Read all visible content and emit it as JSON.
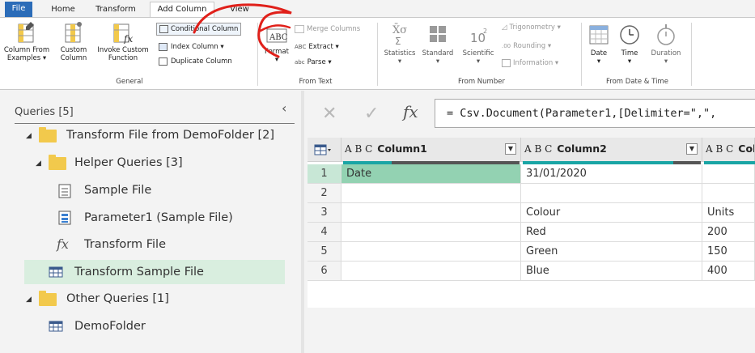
{
  "tabs": [
    "File",
    "Home",
    "Transform",
    "Add Column",
    "View"
  ],
  "ribbon": {
    "general": {
      "column_from_examples": [
        "Column From",
        "Examples"
      ],
      "custom_column": [
        "Custom",
        "Column"
      ],
      "invoke_custom_function": [
        "Invoke Custom",
        "Function"
      ],
      "conditional_column": "Conditional Column",
      "index_column": "Index Column",
      "duplicate_column": "Duplicate Column",
      "group_label": "General"
    },
    "from_text": {
      "format": "Format",
      "merge_columns": "Merge Columns",
      "extract": "Extract",
      "parse": "Parse",
      "group_label": "From Text"
    },
    "from_number": {
      "statistics": "Statistics",
      "standard": "Standard",
      "scientific": "Scientific",
      "trigonometry": "Trigonometry",
      "rounding": "Rounding",
      "information": "Information",
      "group_label": "From Number"
    },
    "from_date_time": {
      "date": "Date",
      "time": "Time",
      "duration": "Duration",
      "group_label": "From Date & Time"
    }
  },
  "queries": {
    "header": "Queries [5]",
    "items": [
      {
        "label": "Transform File from DemoFolder [2]",
        "type": "folder"
      },
      {
        "label": "Helper Queries [3]",
        "type": "folder"
      },
      {
        "label": "Sample File",
        "type": "file"
      },
      {
        "label": "Parameter1 (Sample File)",
        "type": "parameter"
      },
      {
        "label": "Transform File",
        "type": "function"
      },
      {
        "label": "Transform Sample File",
        "type": "table"
      },
      {
        "label": "Other Queries [1]",
        "type": "folder"
      },
      {
        "label": "DemoFolder",
        "type": "table"
      }
    ]
  },
  "formula_bar": {
    "fx": "fx",
    "formula": "= Csv.Document(Parameter1,[Delimiter=\",\","
  },
  "grid": {
    "columns": [
      {
        "type": "A B C",
        "name": "Column1"
      },
      {
        "type": "A B C",
        "name": "Column2"
      },
      {
        "type": "A B C",
        "name": "Colu"
      }
    ],
    "rows": [
      {
        "n": "1",
        "c1": "Date",
        "c2": "31/01/2020",
        "c3": ""
      },
      {
        "n": "2",
        "c1": "",
        "c2": "",
        "c3": ""
      },
      {
        "n": "3",
        "c1": "",
        "c2": "Colour",
        "c3": "Units"
      },
      {
        "n": "4",
        "c1": "",
        "c2": "Red",
        "c3": "200"
      },
      {
        "n": "5",
        "c1": "",
        "c2": "Green",
        "c3": "150"
      },
      {
        "n": "6",
        "c1": "",
        "c2": "Blue",
        "c3": "400"
      }
    ]
  },
  "colors": {
    "file_tab": "#2b6cb8",
    "selected_query": "#d9eedf",
    "highlight_cell": "#93d2b2",
    "quality_bar": "#1aa5a5",
    "annotation": "#e0201a"
  }
}
